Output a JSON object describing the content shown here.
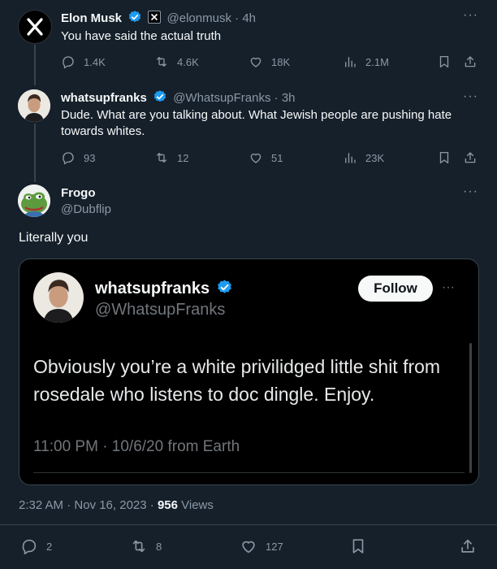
{
  "tweets": [
    {
      "author": "Elon Musk",
      "affiliate_badge": "X",
      "handle": "@elonmusk",
      "time": "4h",
      "text": "You have said the actual truth",
      "replies": "1.4K",
      "reposts": "4.6K",
      "likes": "18K",
      "views": "2.1M"
    },
    {
      "author": "whatsupfranks",
      "handle": "@WhatsupFranks",
      "time": "3h",
      "text": "Dude. What are you talking about. What Jewish people are pushing hate towards whites.",
      "replies": "93",
      "reposts": "12",
      "likes": "51",
      "views": "23K"
    }
  ],
  "main": {
    "author": "Frogo",
    "handle": "@Dubflip",
    "text": "Literally you",
    "timestamp": "2:32 AM · Nov 16, 2023 · ",
    "views_count": "956",
    "views_label": " Views",
    "replies": "2",
    "reposts": "8",
    "likes": "127"
  },
  "quote": {
    "author": "whatsupfranks",
    "handle": "@WhatsupFranks",
    "follow_label": "Follow",
    "text": "Obviously you’re a white privilidged little shit from rosedale who listens to doc dingle. Enjoy.",
    "timestamp": "11:00 PM · 10/6/20 from Earth"
  },
  "colors": {
    "background": "#15202b",
    "verified": "#1d9bf0",
    "muted": "#8b98a5",
    "divider": "#38444d"
  },
  "icons": [
    "x-logo-icon",
    "verified-icon",
    "more-icon",
    "reply-icon",
    "repost-icon",
    "like-icon",
    "views-icon",
    "bookmark-icon",
    "share-icon"
  ]
}
